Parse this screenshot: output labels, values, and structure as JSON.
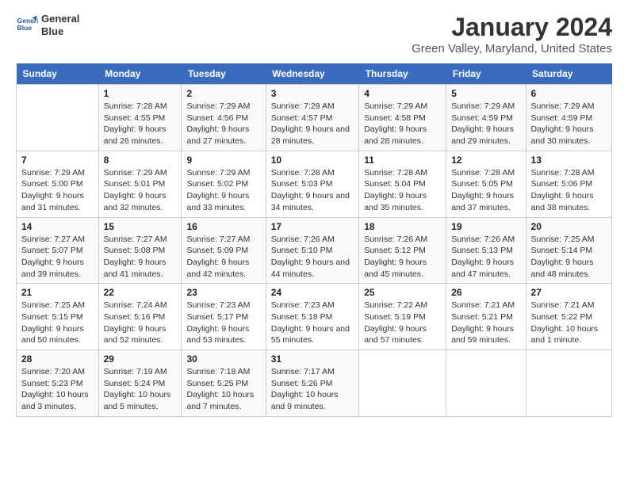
{
  "header": {
    "logo_line1": "General",
    "logo_line2": "Blue",
    "title": "January 2024",
    "subtitle": "Green Valley, Maryland, United States"
  },
  "days_of_week": [
    "Sunday",
    "Monday",
    "Tuesday",
    "Wednesday",
    "Thursday",
    "Friday",
    "Saturday"
  ],
  "weeks": [
    [
      {
        "day": "",
        "sunrise": "",
        "sunset": "",
        "daylight": ""
      },
      {
        "day": "1",
        "sunrise": "Sunrise: 7:28 AM",
        "sunset": "Sunset: 4:55 PM",
        "daylight": "Daylight: 9 hours and 26 minutes."
      },
      {
        "day": "2",
        "sunrise": "Sunrise: 7:29 AM",
        "sunset": "Sunset: 4:56 PM",
        "daylight": "Daylight: 9 hours and 27 minutes."
      },
      {
        "day": "3",
        "sunrise": "Sunrise: 7:29 AM",
        "sunset": "Sunset: 4:57 PM",
        "daylight": "Daylight: 9 hours and 28 minutes."
      },
      {
        "day": "4",
        "sunrise": "Sunrise: 7:29 AM",
        "sunset": "Sunset: 4:58 PM",
        "daylight": "Daylight: 9 hours and 28 minutes."
      },
      {
        "day": "5",
        "sunrise": "Sunrise: 7:29 AM",
        "sunset": "Sunset: 4:59 PM",
        "daylight": "Daylight: 9 hours and 29 minutes."
      },
      {
        "day": "6",
        "sunrise": "Sunrise: 7:29 AM",
        "sunset": "Sunset: 4:59 PM",
        "daylight": "Daylight: 9 hours and 30 minutes."
      }
    ],
    [
      {
        "day": "7",
        "sunrise": "Sunrise: 7:29 AM",
        "sunset": "Sunset: 5:00 PM",
        "daylight": "Daylight: 9 hours and 31 minutes."
      },
      {
        "day": "8",
        "sunrise": "Sunrise: 7:29 AM",
        "sunset": "Sunset: 5:01 PM",
        "daylight": "Daylight: 9 hours and 32 minutes."
      },
      {
        "day": "9",
        "sunrise": "Sunrise: 7:29 AM",
        "sunset": "Sunset: 5:02 PM",
        "daylight": "Daylight: 9 hours and 33 minutes."
      },
      {
        "day": "10",
        "sunrise": "Sunrise: 7:28 AM",
        "sunset": "Sunset: 5:03 PM",
        "daylight": "Daylight: 9 hours and 34 minutes."
      },
      {
        "day": "11",
        "sunrise": "Sunrise: 7:28 AM",
        "sunset": "Sunset: 5:04 PM",
        "daylight": "Daylight: 9 hours and 35 minutes."
      },
      {
        "day": "12",
        "sunrise": "Sunrise: 7:28 AM",
        "sunset": "Sunset: 5:05 PM",
        "daylight": "Daylight: 9 hours and 37 minutes."
      },
      {
        "day": "13",
        "sunrise": "Sunrise: 7:28 AM",
        "sunset": "Sunset: 5:06 PM",
        "daylight": "Daylight: 9 hours and 38 minutes."
      }
    ],
    [
      {
        "day": "14",
        "sunrise": "Sunrise: 7:27 AM",
        "sunset": "Sunset: 5:07 PM",
        "daylight": "Daylight: 9 hours and 39 minutes."
      },
      {
        "day": "15",
        "sunrise": "Sunrise: 7:27 AM",
        "sunset": "Sunset: 5:08 PM",
        "daylight": "Daylight: 9 hours and 41 minutes."
      },
      {
        "day": "16",
        "sunrise": "Sunrise: 7:27 AM",
        "sunset": "Sunset: 5:09 PM",
        "daylight": "Daylight: 9 hours and 42 minutes."
      },
      {
        "day": "17",
        "sunrise": "Sunrise: 7:26 AM",
        "sunset": "Sunset: 5:10 PM",
        "daylight": "Daylight: 9 hours and 44 minutes."
      },
      {
        "day": "18",
        "sunrise": "Sunrise: 7:26 AM",
        "sunset": "Sunset: 5:12 PM",
        "daylight": "Daylight: 9 hours and 45 minutes."
      },
      {
        "day": "19",
        "sunrise": "Sunrise: 7:26 AM",
        "sunset": "Sunset: 5:13 PM",
        "daylight": "Daylight: 9 hours and 47 minutes."
      },
      {
        "day": "20",
        "sunrise": "Sunrise: 7:25 AM",
        "sunset": "Sunset: 5:14 PM",
        "daylight": "Daylight: 9 hours and 48 minutes."
      }
    ],
    [
      {
        "day": "21",
        "sunrise": "Sunrise: 7:25 AM",
        "sunset": "Sunset: 5:15 PM",
        "daylight": "Daylight: 9 hours and 50 minutes."
      },
      {
        "day": "22",
        "sunrise": "Sunrise: 7:24 AM",
        "sunset": "Sunset: 5:16 PM",
        "daylight": "Daylight: 9 hours and 52 minutes."
      },
      {
        "day": "23",
        "sunrise": "Sunrise: 7:23 AM",
        "sunset": "Sunset: 5:17 PM",
        "daylight": "Daylight: 9 hours and 53 minutes."
      },
      {
        "day": "24",
        "sunrise": "Sunrise: 7:23 AM",
        "sunset": "Sunset: 5:18 PM",
        "daylight": "Daylight: 9 hours and 55 minutes."
      },
      {
        "day": "25",
        "sunrise": "Sunrise: 7:22 AM",
        "sunset": "Sunset: 5:19 PM",
        "daylight": "Daylight: 9 hours and 57 minutes."
      },
      {
        "day": "26",
        "sunrise": "Sunrise: 7:21 AM",
        "sunset": "Sunset: 5:21 PM",
        "daylight": "Daylight: 9 hours and 59 minutes."
      },
      {
        "day": "27",
        "sunrise": "Sunrise: 7:21 AM",
        "sunset": "Sunset: 5:22 PM",
        "daylight": "Daylight: 10 hours and 1 minute."
      }
    ],
    [
      {
        "day": "28",
        "sunrise": "Sunrise: 7:20 AM",
        "sunset": "Sunset: 5:23 PM",
        "daylight": "Daylight: 10 hours and 3 minutes."
      },
      {
        "day": "29",
        "sunrise": "Sunrise: 7:19 AM",
        "sunset": "Sunset: 5:24 PM",
        "daylight": "Daylight: 10 hours and 5 minutes."
      },
      {
        "day": "30",
        "sunrise": "Sunrise: 7:18 AM",
        "sunset": "Sunset: 5:25 PM",
        "daylight": "Daylight: 10 hours and 7 minutes."
      },
      {
        "day": "31",
        "sunrise": "Sunrise: 7:17 AM",
        "sunset": "Sunset: 5:26 PM",
        "daylight": "Daylight: 10 hours and 9 minutes."
      },
      {
        "day": "",
        "sunrise": "",
        "sunset": "",
        "daylight": ""
      },
      {
        "day": "",
        "sunrise": "",
        "sunset": "",
        "daylight": ""
      },
      {
        "day": "",
        "sunrise": "",
        "sunset": "",
        "daylight": ""
      }
    ]
  ]
}
